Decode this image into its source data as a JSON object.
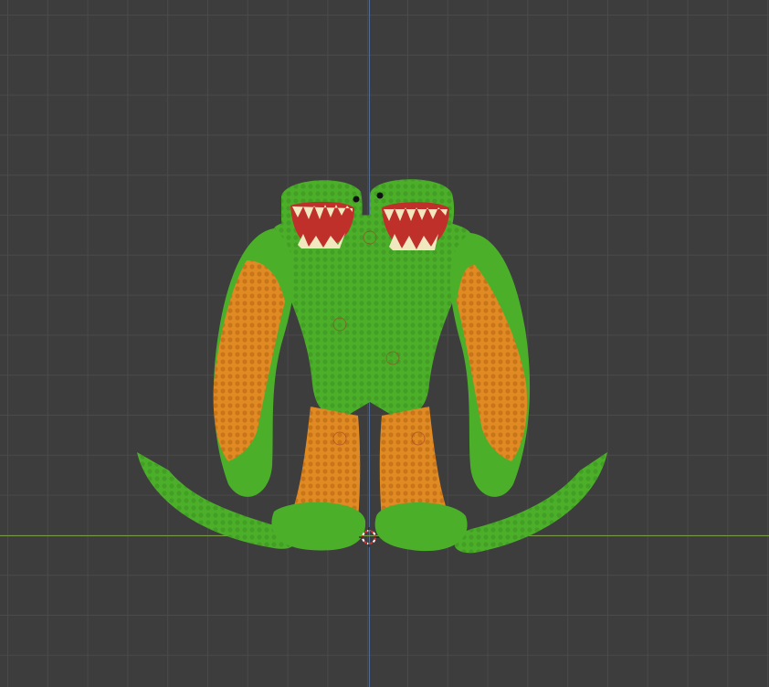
{
  "viewport": {
    "background": "#3d3d3d",
    "grid_line": "#4a4a4a",
    "x_axis_color": "#7b9a4a",
    "z_axis_color": "#5577aa"
  },
  "model": {
    "body_color": "#4caf2a",
    "accent_color": "#e08a24",
    "mouth_color": "#c0302a",
    "teeth_color": "#f2e8c0"
  },
  "cursor": {
    "icon": "3d-cursor-icon",
    "ring_color": "#d33"
  }
}
